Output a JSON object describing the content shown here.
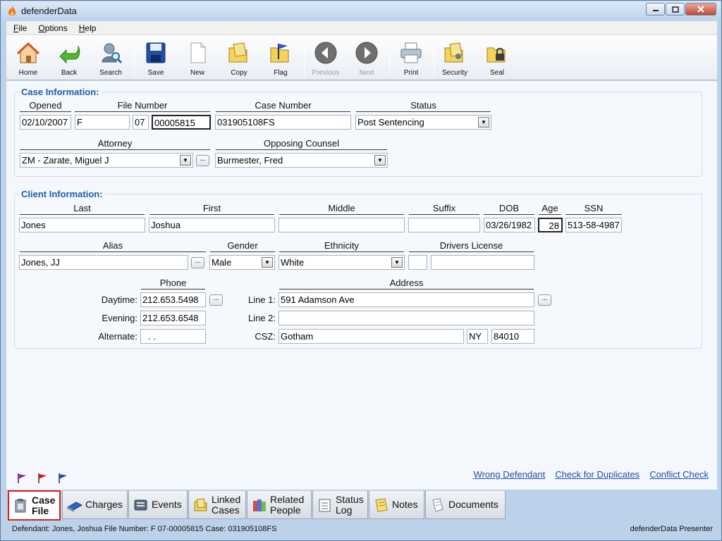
{
  "window": {
    "title": "defenderData"
  },
  "menu": [
    {
      "label": "File",
      "key": "F",
      "rest": "ile"
    },
    {
      "label": "Options",
      "key": "O",
      "rest": "ptions"
    },
    {
      "label": "Help",
      "key": "H",
      "rest": "elp"
    }
  ],
  "toolbar": {
    "home": "Home",
    "back": "Back",
    "search": "Search",
    "save": "Save",
    "new": "New",
    "copy": "Copy",
    "flag": "Flag",
    "previous": "Previous",
    "next": "Next",
    "print": "Print",
    "security": "Security",
    "seal": "Seal"
  },
  "case": {
    "section_title": "Case Information:",
    "labels": {
      "opened": "Opened",
      "file_number": "File Number",
      "case_number": "Case Number",
      "status": "Status",
      "attorney": "Attorney",
      "opposing_counsel": "Opposing Counsel"
    },
    "opened": "02/10/2007",
    "file_prefix": "F",
    "file_year": "07",
    "file_seq": "00005815",
    "case_number": "031905108FS",
    "status": "Post Sentencing",
    "attorney": "ZM - Zarate, Miguel J",
    "opposing_counsel": "Burmester, Fred"
  },
  "client": {
    "section_title": "Client Information:",
    "labels": {
      "last": "Last",
      "first": "First",
      "middle": "Middle",
      "suffix": "Suffix",
      "dob": "DOB",
      "age": "Age",
      "ssn": "SSN",
      "alias": "Alias",
      "gender": "Gender",
      "ethnicity": "Ethnicity",
      "drivers_license": "Drivers License",
      "phone": "Phone",
      "daytime": "Daytime:",
      "evening": "Evening:",
      "alternate": "Alternate:",
      "address": "Address",
      "line1": "Line 1:",
      "line2": "Line 2:",
      "csz": "CSZ:"
    },
    "last": "Jones",
    "first": "Joshua",
    "middle": "",
    "suffix": "",
    "dob": "03/26/1982",
    "age": "28",
    "ssn": "513-58-4987",
    "alias": "Jones, JJ",
    "gender": "Male",
    "ethnicity": "White",
    "dl_state": "",
    "dl_number": "",
    "phone_daytime": "212.653.5498",
    "phone_evening": "212.653.6548",
    "phone_alternate": " .   .",
    "address_line1": "591 Adamson Ave",
    "address_line2": "",
    "city": "Gotham",
    "state": "NY",
    "zip": "84010"
  },
  "ellipsis": "...",
  "links": {
    "wrong_defendant": "Wrong Defendant",
    "check_duplicates": "Check for Duplicates",
    "conflict_check": "Conflict Check"
  },
  "tabs": {
    "case_file_1": "Case",
    "case_file_2": "File",
    "charges": "Charges",
    "events": "Events",
    "linked_1": "Linked",
    "linked_2": "Cases",
    "related_1": "Related",
    "related_2": "People",
    "status_1": "Status",
    "status_2": "Log",
    "notes": "Notes",
    "documents": "Documents"
  },
  "status_bar": {
    "left": "Defendant: Jones, Joshua  File Number: F  07-00005815  Case: 031905108FS",
    "right": "defenderData Presenter"
  },
  "colors": {
    "section_title": "#1f5ea8",
    "link": "#1f4fa0",
    "active_tab_border": "#d4211f"
  }
}
